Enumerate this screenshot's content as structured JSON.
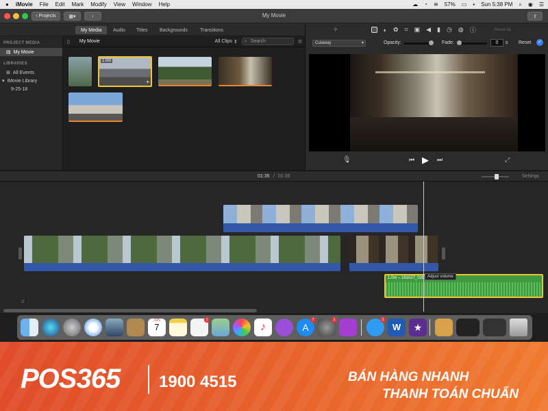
{
  "menubar": {
    "app": "iMovie",
    "items": [
      "File",
      "Edit",
      "Mark",
      "Modify",
      "View",
      "Window",
      "Help"
    ],
    "battery": "57%",
    "clock": "Sun 5:38 PM"
  },
  "toolbar": {
    "projects_label": "Projects",
    "window_title": "My Movie"
  },
  "browser_tabs": [
    "My Media",
    "Audio",
    "Titles",
    "Backgrounds",
    "Transitions"
  ],
  "sidebar": {
    "project_media_header": "PROJECT MEDIA",
    "project_item": "My Movie",
    "libraries_header": "LIBRARIES",
    "all_events": "All Events",
    "library": "iMovie Library",
    "event": "9-25-18"
  },
  "browser": {
    "title": "My Movie",
    "filter": "All Clips",
    "search_placeholder": "Search",
    "selected_clip_duration": "1.0m"
  },
  "viewer": {
    "overlay_mode": "Cutaway",
    "opacity_label": "Opacity:",
    "fade_label": "Fade:",
    "fade_value": "0",
    "fade_unit": "s",
    "reset_label": "Reset",
    "reset_all_label": "Reset All"
  },
  "timeline": {
    "current_time": "01:35",
    "separator": "/",
    "total_time": "01:35",
    "settings_label": "Settings",
    "audio_clip_label": "1.0m – 161027_0281",
    "tooltip": "Adjust volume"
  },
  "dock": {
    "calendar_month": "JUN",
    "calendar_day": "7",
    "badges": {
      "reminders": "1",
      "appstore": "7",
      "prefs": "1",
      "messages": "3"
    }
  },
  "banner": {
    "logo": "POS365",
    "phone": "1900 4515",
    "slogan_line1": "BÁN HÀNG NHANH",
    "slogan_line2": "THANH TOÁN CHUẨN"
  },
  "colors": {
    "accent_blue": "#3a82f7",
    "clip_audio_blue": "#3358a8",
    "audio_green": "#3f9a3f",
    "selection_yellow": "#f2c633",
    "banner_orange": "#e8642c"
  }
}
